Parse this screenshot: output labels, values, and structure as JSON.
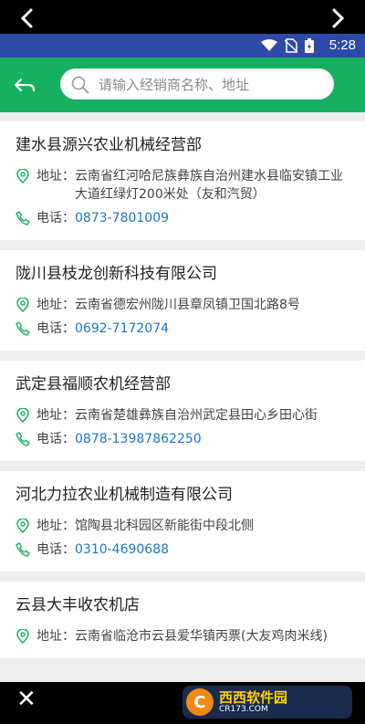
{
  "statusbar": {
    "time": "5:28"
  },
  "search": {
    "placeholder": "请输入经销商名称、地址"
  },
  "labels": {
    "address": "地址：",
    "phone": "电话："
  },
  "dealers": [
    {
      "name": "建水县源兴农业机械经营部",
      "address": "云南省红河哈尼族彝族自治州建水县临安镇工业大道红绿灯200米处（友和汽贸）",
      "phone": "0873-7801009"
    },
    {
      "name": "陇川县枝龙创新科技有限公司",
      "address": "云南省德宏州陇川县章凤镇卫国北路8号",
      "phone": "0692-7172074"
    },
    {
      "name": "武定县福顺农机经营部",
      "address": "云南省楚雄彝族自治州武定县田心乡田心街",
      "phone": "0878-13987862250"
    },
    {
      "name": "河北力拉农业机械制造有限公司",
      "address": "馆陶县北科园区新能街中段北侧",
      "phone": "0310-4690688"
    },
    {
      "name": "云县大丰收农机店",
      "address": "云南省临沧市云县爱华镇丙票(大友鸡肉米线)"
    }
  ],
  "watermark": {
    "logo": "C",
    "text": "西西软件园",
    "sub": "CR173.COM"
  },
  "colors": {
    "accent": "#16b060",
    "statusbar": "#2d4aa8",
    "phone": "#1d76c8"
  }
}
